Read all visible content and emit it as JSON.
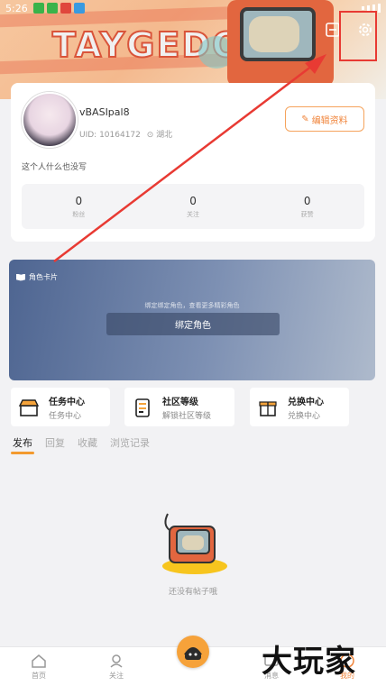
{
  "status_bar": {
    "time": "5:26"
  },
  "banner": {
    "logo_text": "TAYGEDO"
  },
  "profile": {
    "nickname": "vBASIpal8",
    "uid": "UID: 10164172",
    "location": "湖北",
    "edit_label": "编辑资料",
    "bio": "这个人什么也没写",
    "stats": [
      {
        "value": "0",
        "label": "粉丝"
      },
      {
        "value": "0",
        "label": "关注"
      },
      {
        "value": "0",
        "label": "获赞"
      }
    ]
  },
  "role_card": {
    "title": "角色卡片",
    "hint": "绑定绑定角色，查看更多精彩角色",
    "bind_label": "绑定角色"
  },
  "quick_entries": [
    {
      "title": "任务中心",
      "subtitle": "任务中心",
      "icon": "stall-icon"
    },
    {
      "title": "社区等级",
      "subtitle": "解锁社区等级",
      "icon": "clipboard-icon"
    },
    {
      "title": "兑换中心",
      "subtitle": "兑换中心",
      "icon": "gift-box-icon"
    }
  ],
  "tabs": [
    "发布",
    "回复",
    "收藏",
    "浏览记录"
  ],
  "empty_state": {
    "text": "还没有帖子哦"
  },
  "bottom_nav": {
    "home": "首页",
    "follow": "关注",
    "messages": "消息",
    "mine": "我的"
  },
  "watermark": "大玩家",
  "colors": {
    "accent": "#f0843a",
    "annotation": "#e83a33",
    "role_card": "#4e6591"
  }
}
